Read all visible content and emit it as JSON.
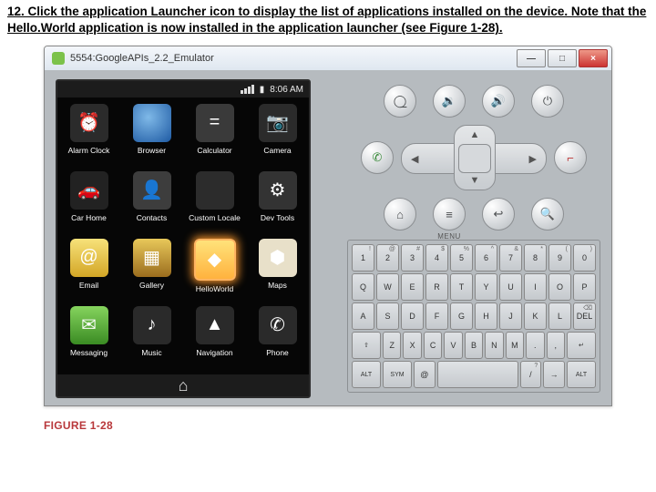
{
  "instruction": "12. Click the application Launcher icon to display the list of applications installed on the device. Note that the Hello.World application is now installed in the application launcher (see Figure 1-28).",
  "window": {
    "title": "5554:GoogleAPIs_2.2_Emulator",
    "min": "—",
    "max": "□",
    "close": "×"
  },
  "status": {
    "signal_bars": 4,
    "battery": "▮",
    "time": "8:06 AM"
  },
  "apps": [
    {
      "label": "Alarm Clock",
      "glyph": "⏰",
      "cls": "i-clock"
    },
    {
      "label": "Browser",
      "glyph": "",
      "cls": "i-browser"
    },
    {
      "label": "Calculator",
      "glyph": "=",
      "cls": "i-calc"
    },
    {
      "label": "Camera",
      "glyph": "📷",
      "cls": "i-cam"
    },
    {
      "label": "Car Home",
      "glyph": "🚗",
      "cls": "i-car"
    },
    {
      "label": "Contacts",
      "glyph": "👤",
      "cls": "i-contacts"
    },
    {
      "label": "Custom Locale",
      "glyph": "",
      "cls": "i-locale"
    },
    {
      "label": "Dev Tools",
      "glyph": "⚙",
      "cls": "i-dev"
    },
    {
      "label": "Email",
      "glyph": "@",
      "cls": "i-mail"
    },
    {
      "label": "Gallery",
      "glyph": "▦",
      "cls": "i-gallery"
    },
    {
      "label": "HelloWorld",
      "glyph": "◆",
      "cls": "i-hw",
      "selected": true
    },
    {
      "label": "Maps",
      "glyph": "⬢",
      "cls": "i-maps"
    },
    {
      "label": "Messaging",
      "glyph": "✉",
      "cls": "i-msg"
    },
    {
      "label": "Music",
      "glyph": "♪",
      "cls": "i-music"
    },
    {
      "label": "Navigation",
      "glyph": "▲",
      "cls": "i-nav"
    },
    {
      "label": "Phone",
      "glyph": "✆",
      "cls": "i-phone"
    }
  ],
  "nav_home_glyph": "⌂",
  "controls": {
    "row1": [
      {
        "name": "camera-icon",
        "g": "◯̲"
      },
      {
        "name": "volume-down-icon",
        "g": "🔉"
      },
      {
        "name": "volume-up-icon",
        "g": "🔊"
      },
      {
        "name": "power-icon",
        "g": "⏻"
      }
    ],
    "dpad": {
      "up": "▲",
      "down": "▼",
      "left": "◀",
      "right": "▶"
    },
    "phone_call": "✆",
    "phone_end": "⌐",
    "row3": [
      {
        "name": "home-icon",
        "g": "⌂"
      },
      {
        "name": "menu-icon",
        "g": "≡",
        "lbl": "MENU"
      },
      {
        "name": "back-icon",
        "g": "↩"
      },
      {
        "name": "search-icon",
        "g": "🔍"
      }
    ]
  },
  "keyboard": [
    [
      {
        "m": "1",
        "s": "!"
      },
      {
        "m": "2",
        "s": "@"
      },
      {
        "m": "3",
        "s": "#"
      },
      {
        "m": "4",
        "s": "$"
      },
      {
        "m": "5",
        "s": "%"
      },
      {
        "m": "6",
        "s": "^"
      },
      {
        "m": "7",
        "s": "&"
      },
      {
        "m": "8",
        "s": "*"
      },
      {
        "m": "9",
        "s": "("
      },
      {
        "m": "0",
        "s": ")"
      }
    ],
    [
      {
        "m": "Q"
      },
      {
        "m": "W"
      },
      {
        "m": "E"
      },
      {
        "m": "R"
      },
      {
        "m": "T"
      },
      {
        "m": "Y"
      },
      {
        "m": "U"
      },
      {
        "m": "I"
      },
      {
        "m": "O"
      },
      {
        "m": "P"
      }
    ],
    [
      {
        "m": "A"
      },
      {
        "m": "S"
      },
      {
        "m": "D"
      },
      {
        "m": "F"
      },
      {
        "m": "G"
      },
      {
        "m": "H"
      },
      {
        "m": "J"
      },
      {
        "m": "K"
      },
      {
        "m": "L"
      },
      {
        "m": "DEL",
        "s": "⌫"
      }
    ],
    [
      {
        "m": "⇧",
        "side": true
      },
      {
        "m": "Z"
      },
      {
        "m": "X"
      },
      {
        "m": "C"
      },
      {
        "m": "V"
      },
      {
        "m": "B"
      },
      {
        "m": "N"
      },
      {
        "m": "M"
      },
      {
        "m": "."
      },
      {
        "m": ",",
        "s": ""
      },
      {
        "m": "↵",
        "side": true
      }
    ],
    [
      {
        "m": "ALT",
        "side": true
      },
      {
        "m": "SYM",
        "side": true
      },
      {
        "m": "@"
      },
      {
        "m": " ",
        "wide": true
      },
      {
        "m": "/",
        "s": "?"
      },
      {
        "m": "→"
      },
      {
        "m": "ALT",
        "side": true
      }
    ]
  ],
  "figure_caption": "FIGURE 1-28"
}
